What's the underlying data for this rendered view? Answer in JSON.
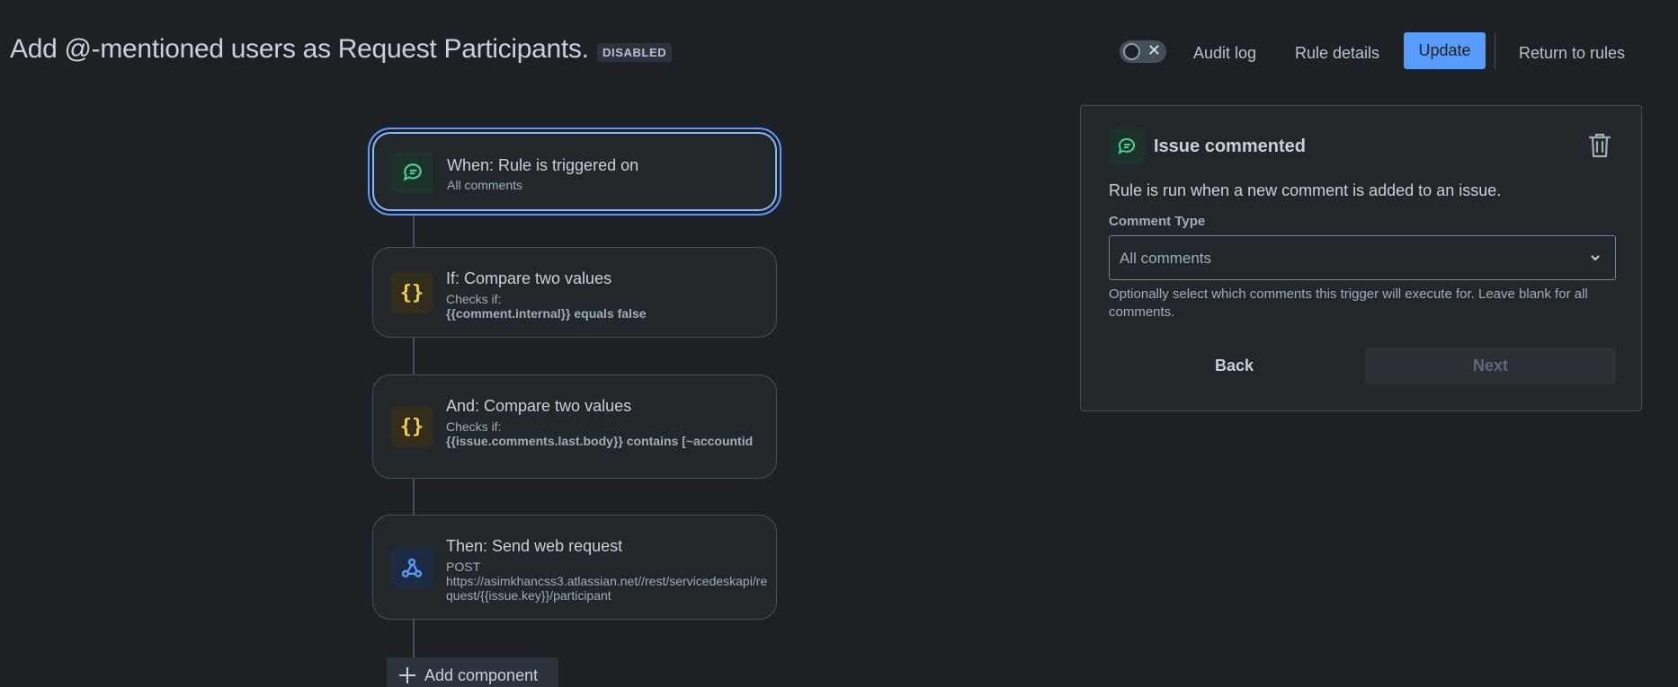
{
  "header": {
    "title": "Add @-mentioned users as Request Participants.",
    "status_badge": "DISABLED",
    "toggle_symbol": "✕",
    "audit_log_label": "Audit log",
    "rule_details_label": "Rule details",
    "update_label": "Update",
    "return_label": "Return to rules"
  },
  "flow": {
    "trigger": {
      "icon": "comment-icon",
      "title": "When: Rule is triggered on",
      "subtitle": "All comments"
    },
    "condition1": {
      "icon": "braces-icon",
      "title": "If: Compare two values",
      "subtitle": "Checks if:",
      "detail": "{{comment.internal}} equals false"
    },
    "condition2": {
      "icon": "braces-icon",
      "title": "And: Compare two values",
      "subtitle": "Checks if:",
      "detail": "{{issue.comments.last.body}} contains [~accountid"
    },
    "action": {
      "icon": "webhook-icon",
      "title": "Then: Send web request",
      "subtitle": "POST",
      "detail": "https://asimkhancss3.atlassian.net//rest/servicedeskapi/request/{{issue.key}}/participant"
    },
    "add_component_label": "Add component"
  },
  "panel": {
    "icon": "comment-icon",
    "title": "Issue commented",
    "description": "Rule is run when a new comment is added to an issue.",
    "field_label": "Comment Type",
    "field_value": "All comments",
    "help_text": "Optionally select which comments this trigger will execute for. Leave blank for all comments.",
    "back_label": "Back",
    "next_label": "Next"
  },
  "colors": {
    "background": "#1d2125",
    "accent": "#579dff",
    "trigger_icon": "#4bce97",
    "condition_icon": "#f5cd47",
    "action_icon": "#579dff"
  }
}
